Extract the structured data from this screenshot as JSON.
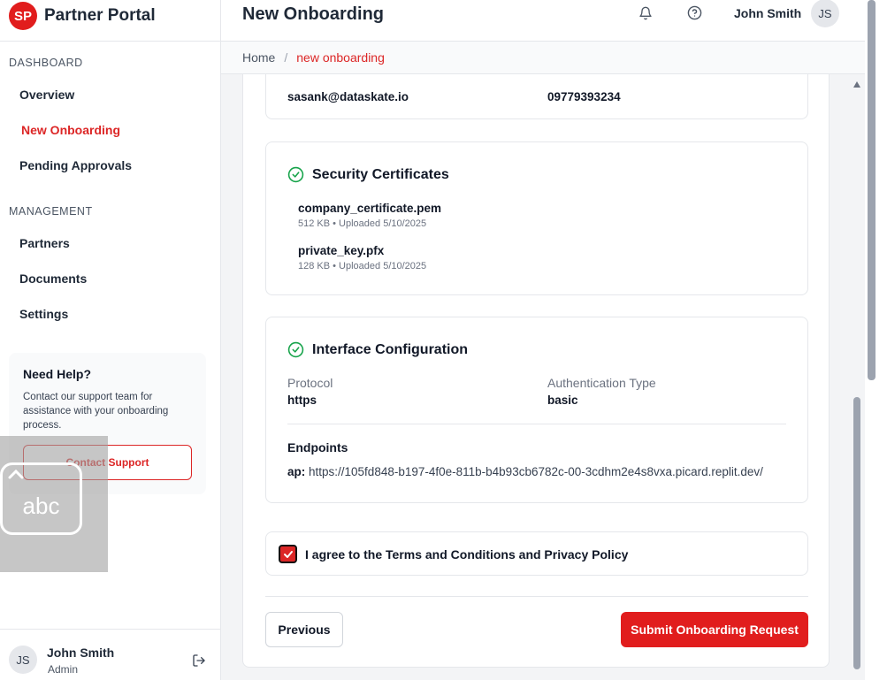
{
  "app": {
    "logo": "SP",
    "name": "Partner Portal"
  },
  "sidebar": {
    "sections": [
      {
        "label": "DASHBOARD",
        "items": [
          "Overview",
          "New Onboarding",
          "Pending Approvals"
        ]
      },
      {
        "label": "MANAGEMENT",
        "items": [
          "Partners",
          "Documents",
          "Settings"
        ]
      }
    ],
    "active_item": "New Onboarding",
    "help": {
      "title": "Need Help?",
      "text": "Contact our support team for assistance with your onboarding process.",
      "button": "Contact Support"
    },
    "user": {
      "initials": "JS",
      "name": "John Smith",
      "role": "Admin"
    }
  },
  "header": {
    "title": "New Onboarding",
    "user_name": "John Smith",
    "user_initials": "JS"
  },
  "breadcrumb": {
    "home": "Home",
    "separator": "/",
    "current": "new onboarding"
  },
  "contact_card": {
    "email": "sasank@dataskate.io",
    "phone": "09779393234"
  },
  "certificates": {
    "title": "Security Certificates",
    "files": [
      {
        "name": "company_certificate.pem",
        "meta": "512 KB • Uploaded 5/10/2025"
      },
      {
        "name": "private_key.pfx",
        "meta": "128 KB • Uploaded 5/10/2025"
      }
    ]
  },
  "interface": {
    "title": "Interface Configuration",
    "protocol_label": "Protocol",
    "protocol_value": "https",
    "auth_label": "Authentication Type",
    "auth_value": "basic",
    "endpoints_label": "Endpoints",
    "endpoint_key": "ap:",
    "endpoint_url": "https://105fd848-b197-4f0e-811b-b4b93cb6782c-00-3cdhm2e4s8vxa.picard.replit.dev/"
  },
  "agreement": {
    "label": "I agree to the Terms and Conditions and Privacy Policy",
    "checked": true
  },
  "actions": {
    "previous": "Previous",
    "submit": "Submit Onboarding Request"
  },
  "overlay": {
    "keyboard_text": "abc"
  },
  "colors": {
    "accent": "#e11d1d",
    "success": "#16a34a"
  }
}
